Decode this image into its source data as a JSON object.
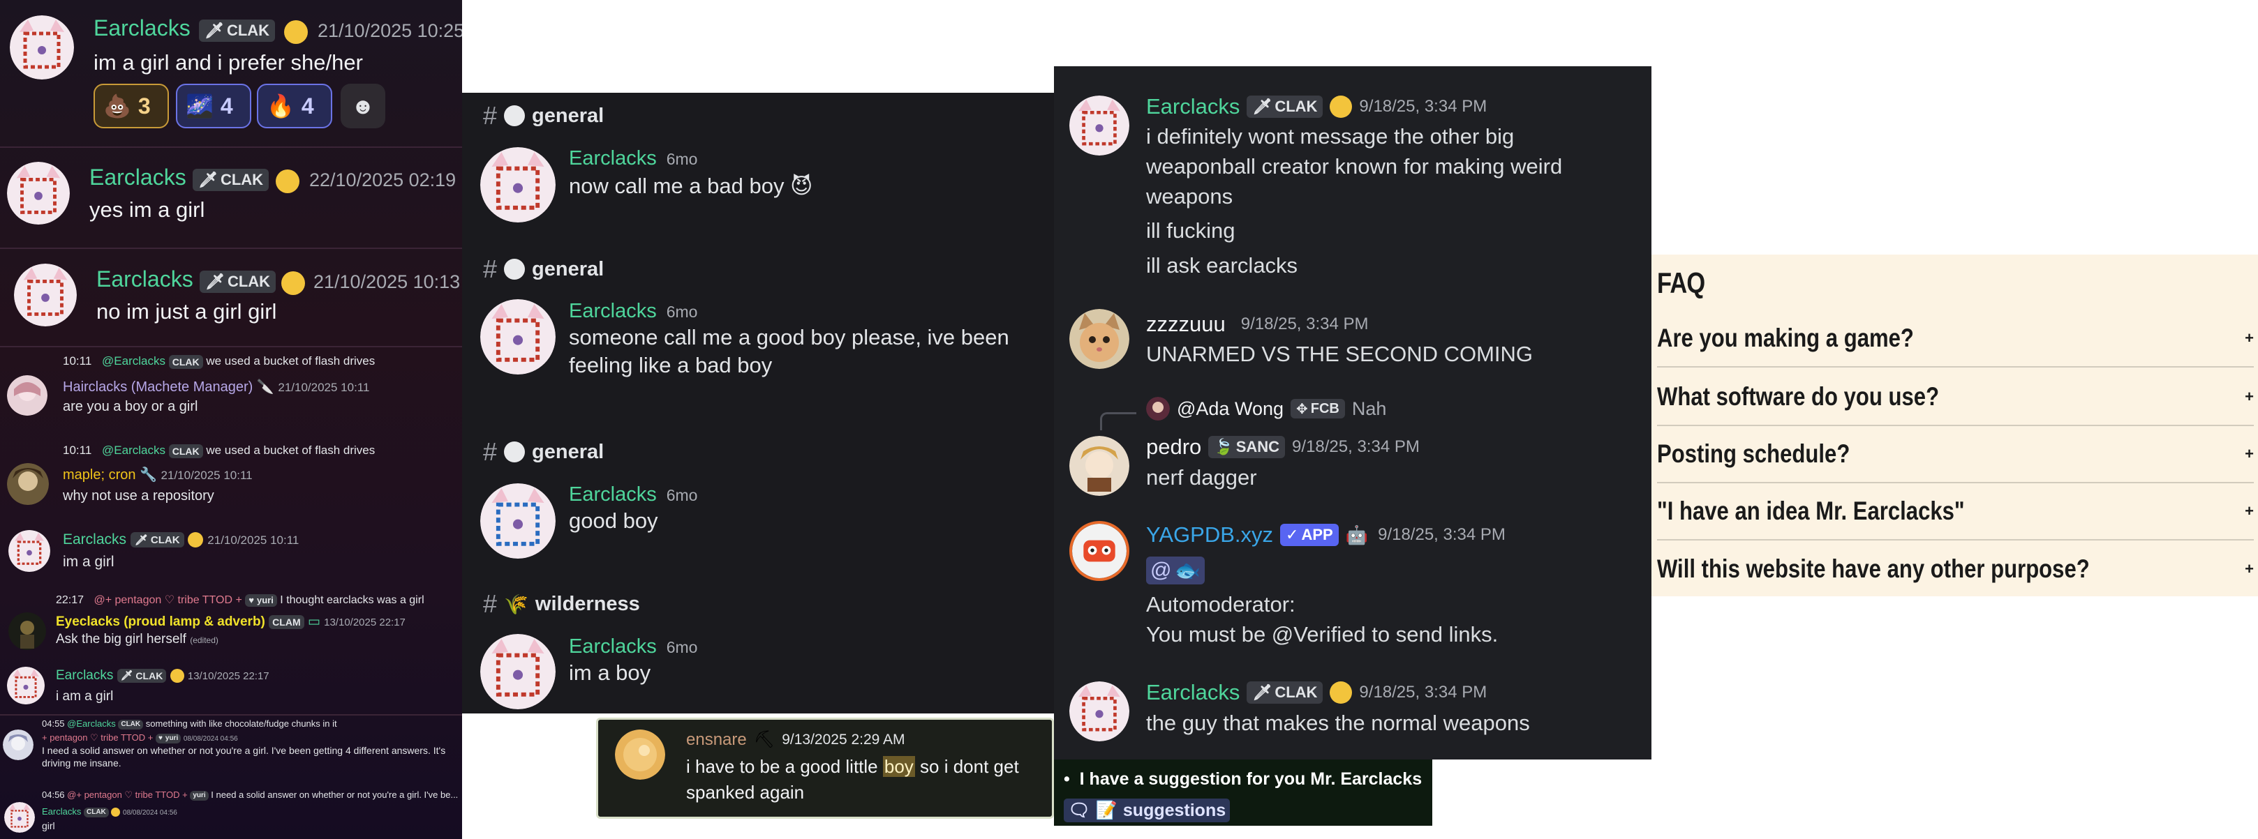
{
  "panel_a": {
    "msg1": {
      "author": "Earclacks",
      "tag": "CLAK",
      "timestamp": "21/10/2025 10:25",
      "text": "im a girl and i prefer she/her",
      "reactions": [
        {
          "icon": "poop-emoji",
          "count": "3"
        },
        {
          "icon": "sparkle-image-emoji",
          "count": "4"
        },
        {
          "icon": "fire-emoji",
          "count": "4"
        },
        {
          "icon": "add-reaction-icon",
          "count": ""
        }
      ]
    },
    "msg2": {
      "author": "Earclacks",
      "tag": "CLAK",
      "timestamp": "22/10/2025 02:19",
      "text": "yes im a girl"
    },
    "msg3": {
      "author": "Earclacks",
      "tag": "CLAK",
      "timestamp": "21/10/2025 10:13",
      "text": "no im just a girl girl"
    },
    "msg4": {
      "reply_time": "10:11",
      "reply_to": "@Earclacks",
      "reply_tag": "CLAK",
      "reply_text": "we used a bucket of flash drives",
      "author": "Hairclacks (Machete Manager)",
      "timestamp": "21/10/2025 10:11",
      "text": "are you a boy or a girl"
    },
    "msg5": {
      "reply_time": "10:11",
      "reply_to": "@Earclacks",
      "reply_tag": "CLAK",
      "reply_text": "we used a bucket of flash drives",
      "author": "maple; cron",
      "timestamp": "21/10/2025 10:11",
      "text": "why not use a repository"
    },
    "msg6": {
      "author": "Earclacks",
      "tag": "CLAK",
      "timestamp": "21/10/2025 10:11",
      "text": "im a girl"
    },
    "msg7": {
      "reply_time": "22:17",
      "reply_to": "@+ pentagon ♡ tribe TTOD +",
      "reply_tag": "yuri",
      "reply_text": "I thought earclacks was a girl",
      "author": "Eyeclacks (proud lamp & adverb)",
      "tag": "CLAM",
      "timestamp": "13/10/2025 22:17",
      "text": "Ask the big girl herself",
      "edited": "(edited)"
    },
    "msg8": {
      "author": "Earclacks",
      "tag": "CLAK",
      "timestamp": "13/10/2025 22:17",
      "text": "i am a girl"
    },
    "msg9": {
      "reply_time": "04:55",
      "reply_to": "@Earclacks",
      "reply_tag": "CLAK",
      "reply_text": "something with like chocolate/fudge chunks in it",
      "author": "+ pentagon ♡ tribe TTOD +",
      "tag": "yuri",
      "timestamp": "08/08/2024 04:56",
      "text_line1": "I need a solid answer on whether or not you're a girl. I've been getting 4 different answers. It's",
      "text_line2": "driving me insane."
    },
    "msg10": {
      "reply_time": "04:56",
      "reply_to": "@+ pentagon ♡ tribe TTOD +",
      "reply_tag": "yuri",
      "reply_text": "I need a solid answer on whether or not you're a girl. I've be...",
      "author": "Earclacks",
      "tag": "CLAK",
      "timestamp": "08/08/2024 04:56",
      "text": "girl"
    }
  },
  "panel_b": {
    "blocks": [
      {
        "channel": "general",
        "author": "Earclacks",
        "age": "6mo",
        "text": "now call me a bad boy 😈"
      },
      {
        "channel": "general",
        "author": "Earclacks",
        "age": "6mo",
        "text": "someone call me a good boy please, ive been feeling like a bad boy"
      },
      {
        "channel": "general",
        "author": "Earclacks",
        "age": "6mo",
        "text": "good boy"
      },
      {
        "channel": "wilderness",
        "author": "Earclacks",
        "age": "6mo",
        "text": "im a boy"
      }
    ]
  },
  "panel_c": {
    "msg1": {
      "author": "Earclacks",
      "tag": "CLAK",
      "timestamp": "9/18/25, 3:34 PM",
      "lines": [
        "i definitely wont message the other big",
        "weaponball creator known for making weird",
        "weapons"
      ],
      "line2": "ill fucking",
      "line3": "ill ask earclacks"
    },
    "msg2": {
      "author": "zzzzuuu",
      "timestamp": "9/18/25, 3:34 PM",
      "text": "UNARMED VS THE SECOND COMING"
    },
    "msg3": {
      "reply_to": "@Ada Wong",
      "reply_tag": "FCB",
      "reply_text": "Nah",
      "author": "pedro",
      "tag": "SANC",
      "timestamp": "9/18/25, 3:34 PM",
      "text": "nerf dagger"
    },
    "msg4": {
      "author": "YAGPDB.xyz",
      "tag": "APP",
      "timestamp": "9/18/25, 3:34 PM",
      "mention": "@",
      "line1": "Automoderator:",
      "line2": "You must be @Verified to send links."
    },
    "msg5": {
      "author": "Earclacks",
      "tag": "CLAK",
      "timestamp": "9/18/25, 3:34 PM",
      "text": "the guy that makes the normal weapons"
    }
  },
  "faq": {
    "title": "FAQ",
    "questions": [
      "Are you making a game?",
      "What software do you use?",
      "Posting schedule?",
      "\"I have an idea Mr. Earclacks\"",
      "Will this website have any other purpose?"
    ],
    "expand_symbol": "+"
  },
  "ensnare": {
    "author": "ensnare",
    "timestamp": "9/13/2025 2:29 AM",
    "text_before": "i have to be a good little ",
    "highlight": "boy",
    "text_after": " so i dont get",
    "line2": "spanked again"
  },
  "suggestion": {
    "bullet": "I have a suggestion for you Mr. Earclacks",
    "channel": "suggestions"
  },
  "colors": {
    "earclacks_green": "#4fd69c",
    "yellow_name": "#f0c419",
    "faq_bg": "#fcf3e3",
    "discord_bg": "#1e1f23",
    "app_badge": "#5865f2"
  }
}
